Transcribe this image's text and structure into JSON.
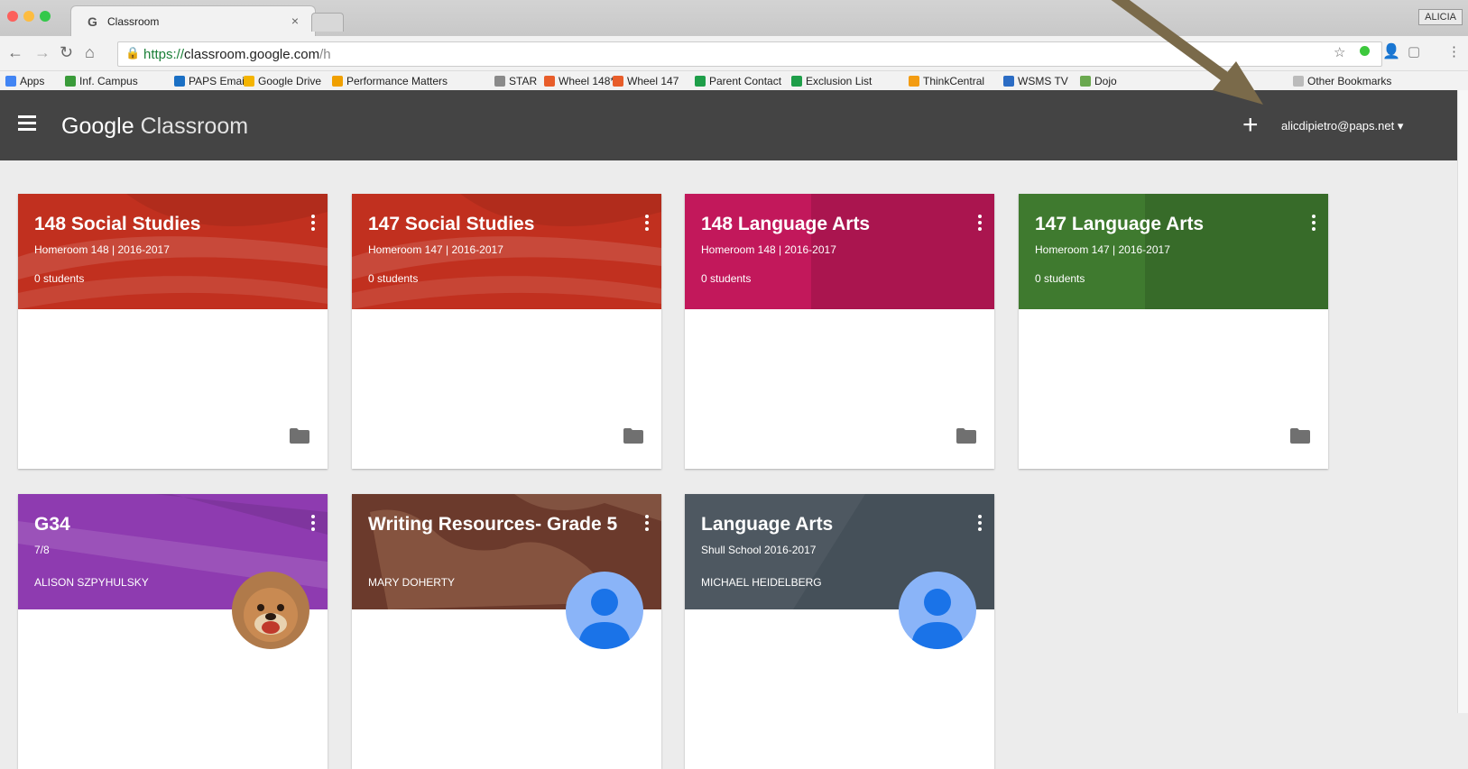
{
  "browser": {
    "tab_favicon": "G",
    "tab_title": "Classroom",
    "tab_close": "×",
    "profile": "ALICIA",
    "url_scheme": "https://",
    "url_host": "classroom.google.com",
    "url_path": "/h",
    "bookmarks": [
      {
        "label": "Apps",
        "color": "#4285f4"
      },
      {
        "label": "Inf. Campus",
        "color": "#3a9b3a"
      },
      {
        "label": "PAPS Email",
        "color": "#1a6fc4"
      },
      {
        "label": "Google Drive",
        "color": "#f4b400"
      },
      {
        "label": "Performance Matters",
        "color": "#f0a000"
      },
      {
        "label": "STAR",
        "color": "#8a8a8a"
      },
      {
        "label": "Wheel 148*",
        "color": "#e85d2a"
      },
      {
        "label": "Wheel 147",
        "color": "#e85d2a"
      },
      {
        "label": "Parent Contact",
        "color": "#1e9e49"
      },
      {
        "label": "Exclusion List",
        "color": "#1e9e49"
      },
      {
        "label": "ThinkCentral",
        "color": "#f39c12"
      },
      {
        "label": "WSMS TV",
        "color": "#2b6cc4"
      },
      {
        "label": "Dojo",
        "color": "#6aa84f"
      },
      {
        "label": "Other Bookmarks",
        "color": "#bbbbbb"
      }
    ]
  },
  "app": {
    "brand_google": "Google",
    "brand_classroom": "Classroom",
    "plus_label": "+",
    "account": "alicdipietro@paps.net",
    "account_caret": "▾"
  },
  "classes": [
    {
      "title": "148 Social Studies",
      "section": "Homeroom 148 | 2016-2017",
      "students": "0 students",
      "color": "#c1301f",
      "theme": "flag"
    },
    {
      "title": "147 Social Studies",
      "section": "Homeroom 147 | 2016-2017",
      "students": "0 students",
      "color": "#c1301f",
      "theme": "flag"
    },
    {
      "title": "148 Language Arts",
      "section": "Homeroom 148 | 2016-2017",
      "students": "0 students",
      "color": "#c2185b",
      "theme": "words"
    },
    {
      "title": "147 Language Arts",
      "section": "Homeroom 147 | 2016-2017",
      "students": "0 students",
      "color": "#3f7a2f",
      "theme": "words"
    },
    {
      "title": "G34",
      "section": "7/8",
      "owner": "ALISON SZPYHULSKY",
      "color": "#8e3bb0",
      "theme": "ribbon",
      "avatar": "dog"
    },
    {
      "title": "Writing Resources- Grade 5",
      "owner": "MARY DOHERTY",
      "color": "#6b3a2c",
      "theme": "map",
      "avatar": "default"
    },
    {
      "title": "Language Arts",
      "section": "Shull School 2016-2017",
      "owner": "MICHAEL HEIDELBERG",
      "color": "#455059",
      "theme": "slate",
      "avatar": "default"
    }
  ],
  "icons": {
    "menu": "hamburger-menu-icon",
    "folder": "folder-icon",
    "kebab": "more-vert-icon",
    "lock": "lock-icon"
  }
}
